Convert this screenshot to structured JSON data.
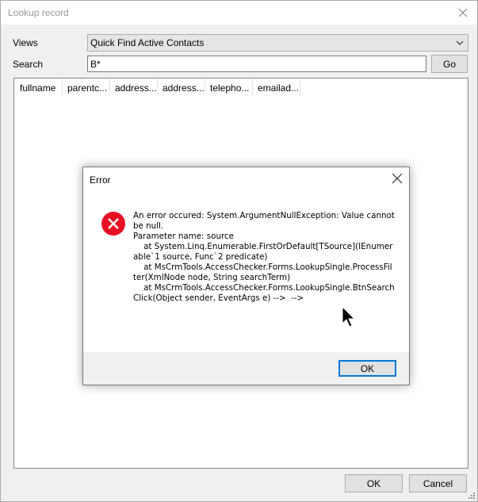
{
  "window": {
    "title": "Lookup record"
  },
  "form": {
    "views_label": "Views",
    "views_value": "Quick Find Active Contacts",
    "search_label": "Search",
    "search_value": "B*",
    "go_label": "Go"
  },
  "grid": {
    "columns": [
      "fullname",
      "parentc...",
      "address...",
      "address...",
      "telepho...",
      "emailad..."
    ]
  },
  "error_dialog": {
    "title": "Error",
    "message": "An error occured: System.ArgumentNullException: Value cannot be null.\nParameter name: source\n    at System.Linq.Enumerable.FirstOrDefault[TSource](IEnumerable`1 source, Func`2 predicate)\n    at MsCrmTools.AccessChecker.Forms.LookupSingle.ProcessFilter(XmlNode node, String searchTerm)\n    at MsCrmTools.AccessChecker.Forms.LookupSingle.BtnSearchClick(Object sender, EventArgs e) -->  -->",
    "ok_label": "OK"
  },
  "footer": {
    "ok_label": "OK",
    "cancel_label": "Cancel"
  },
  "colors": {
    "error_red": "#e81123",
    "focus_blue": "#0078d7"
  }
}
